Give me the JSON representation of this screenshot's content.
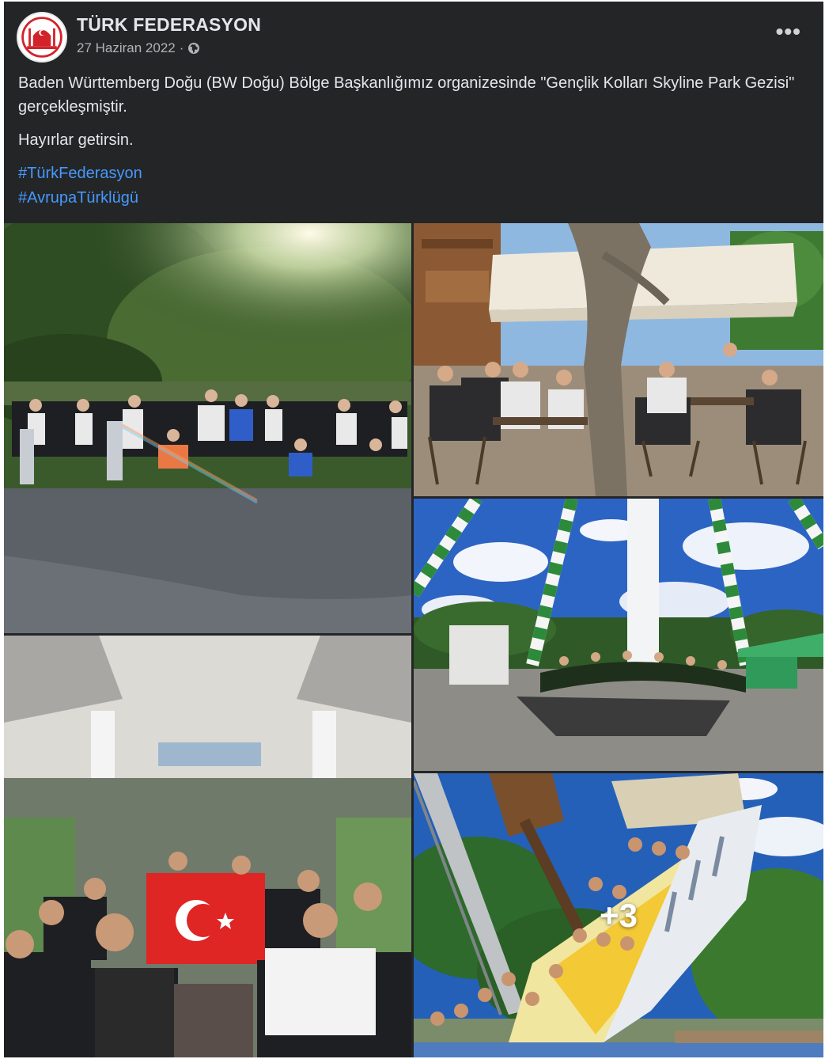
{
  "post": {
    "author": "TÜRK FEDERASYON",
    "date": "27 Haziran 2022",
    "date_separator": "·",
    "audience_icon": "globe-icon",
    "menu_icon": "more-options-icon",
    "menu_label": "•••",
    "paragraphs": [
      "Baden Württemberg Doğu (BW Doğu) Bölge Başkanlığımız organizesinde \"Gençlik Kolları Skyline Park Gezisi\" gerçekleşmiştir.",
      "Hayırlar getirsin."
    ],
    "hashtags": [
      "#TürkFederasyon",
      "#AvrupaTürklügü"
    ]
  },
  "photos": {
    "more_count": "+3"
  },
  "colors": {
    "background": "#242526",
    "text": "#e4e6eb",
    "secondary_text": "#b0b3b8",
    "link": "#4599ff",
    "logo_red": "#d2232a"
  }
}
